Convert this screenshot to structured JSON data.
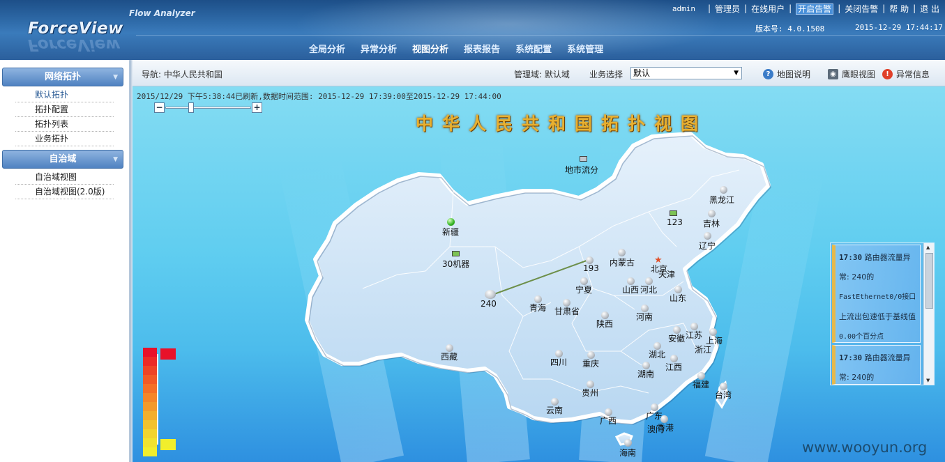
{
  "header": {
    "logo": "ForceView",
    "product": "Flow Analyzer",
    "user": "admin",
    "links": [
      "管理员",
      "在线用户",
      "开启告警",
      "关闭告警",
      "帮 助",
      "退 出"
    ],
    "version": "版本号: 4.0.1508",
    "datetime": "2015-12-29 17:44:17",
    "nav": [
      "全局分析",
      "异常分析",
      "视图分析",
      "报表报告",
      "系统配置",
      "系统管理"
    ],
    "active_nav": "视图分析"
  },
  "sidebar": {
    "sections": [
      {
        "title": "网络拓扑",
        "items": [
          "默认拓扑",
          "拓扑配置",
          "拓扑列表",
          "业务拓扑"
        ]
      },
      {
        "title": "自治域",
        "items": [
          "自治域视图",
          "自治域视图(2.0版)"
        ]
      }
    ]
  },
  "toolbar": {
    "breadcrumb": "导航: 中华人民共和国",
    "domain": "管理域: 默认域",
    "biz_label": "业务选择",
    "biz_value": "默认",
    "map_help": "地图说明",
    "eagle_view": "鹰眼视图",
    "anomaly_info": "异常信息"
  },
  "map": {
    "refresh_text": "2015/12/29 下午5:38:44已刷新,数据时间范围: 2015-12-29 17:39:00至2015-12-29 17:44:00",
    "title": "中华人民共和国拓扑视图",
    "zoom_level": 0.33,
    "nodes": {
      "citylink": "地市流分",
      "heilongjiang": "黑龙江",
      "jilin": "吉林",
      "n123": "123",
      "liaoning": "辽宁",
      "xinjiang": "新疆",
      "n30": "30机器",
      "n193": "193",
      "neimenggu": "内蒙古",
      "beijing": "北京",
      "tianjin": "天津",
      "ningxia": "宁夏",
      "shanxi": "山西",
      "hebei": "河北",
      "n240": "240",
      "qinghai": "青海",
      "gansu": "甘肃省",
      "shandong": "山东",
      "shaanxi": "陕西",
      "henan": "河南",
      "anhui": "安徽",
      "jiangsu": "江苏",
      "shanghai": "上海",
      "zhejiang": "浙江",
      "xizang": "西藏",
      "hubei": "湖北",
      "sichuan": "四川",
      "chongqing": "重庆",
      "jiangxi": "江西",
      "hunan": "湖南",
      "fujian": "福建",
      "guizhou": "贵州",
      "taiwan": "台湾",
      "yunnan": "云南",
      "guangxi": "广西",
      "guangdong": "广东",
      "hongkong": "香港",
      "macau": "澳门",
      "hainan": "海南"
    },
    "legend_colors": [
      "#e8112a",
      "#ec2b27",
      "#ef4426",
      "#f25a26",
      "#f47027",
      "#f48629",
      "#f39a2b",
      "#f3ae2d",
      "#f2c22e",
      "#f2d42f",
      "#f1e22f",
      "#f1ee2c"
    ]
  },
  "alerts": [
    {
      "time": "17:30",
      "text1": "路由器流量异",
      "text2": "常: 240的",
      "text3": "FastEthernet0/0接口",
      "text4": "上流出包速低于基线值",
      "text5": "0.00个百分点"
    },
    {
      "time": "17:30",
      "text1": "路由器流量异",
      "text2": "常: 240的"
    }
  ],
  "watermark": "www.wooyun.org",
  "colors": {
    "header": "#2e6aa8",
    "sidebar_head": "#5a8cc8",
    "map_bg": "#5fcdf0",
    "title": "#e8b030"
  }
}
